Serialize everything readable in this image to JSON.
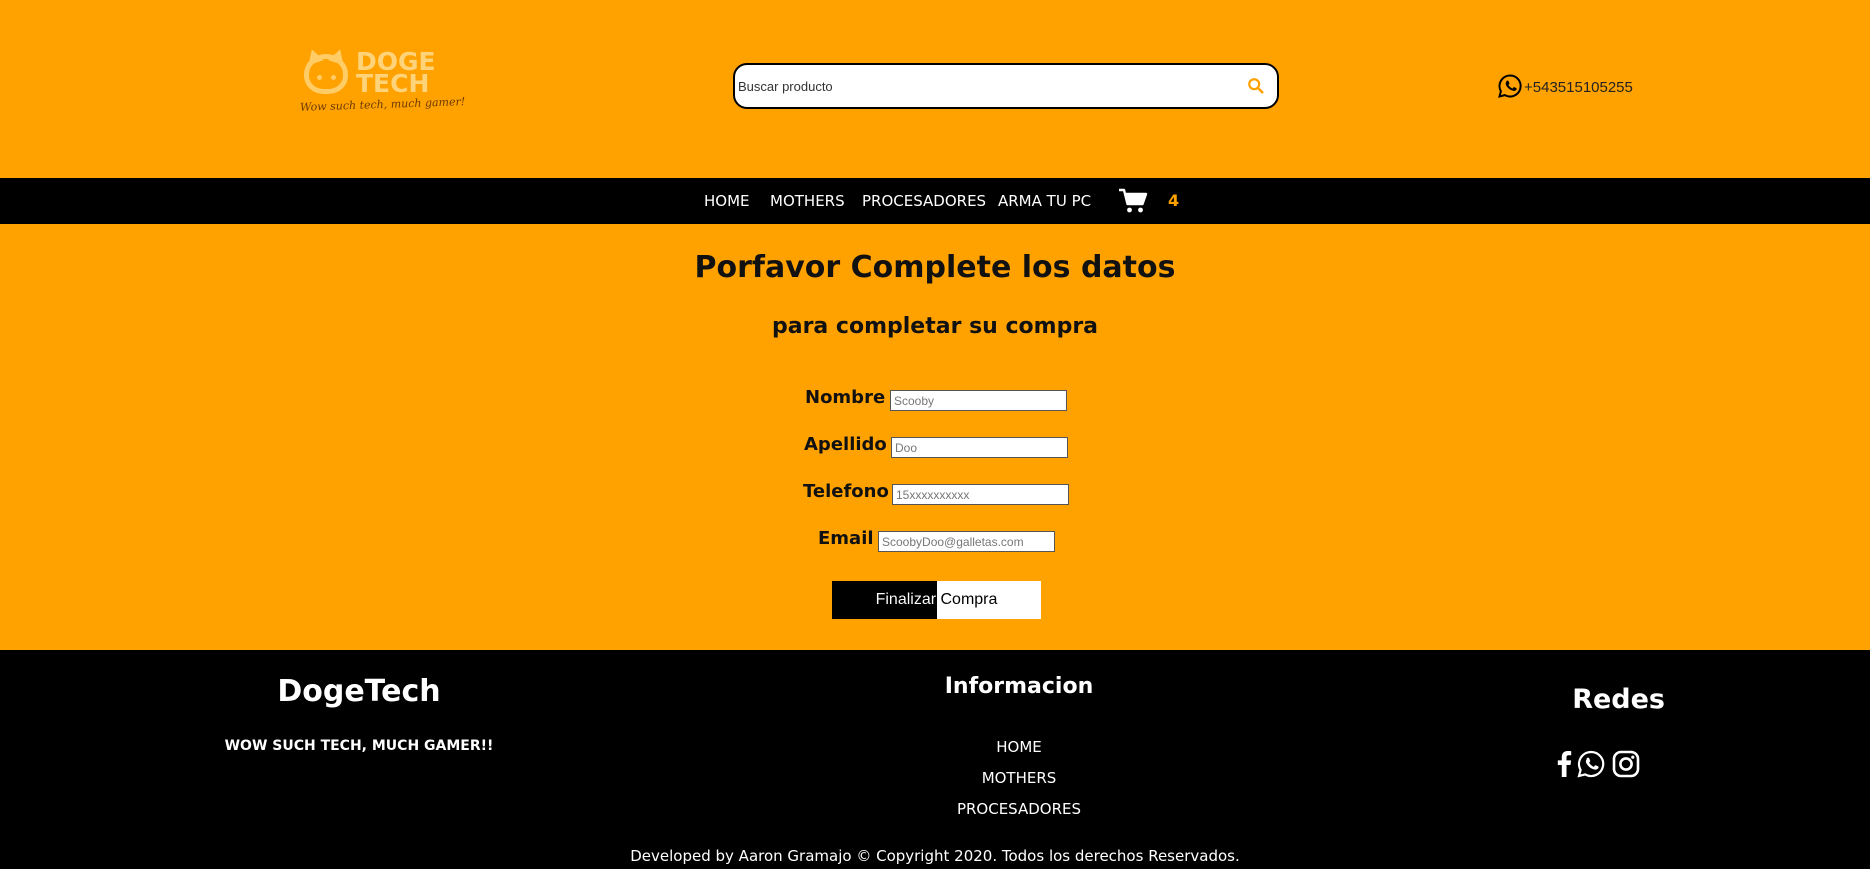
{
  "header": {
    "logo": {
      "line1": "DOGE",
      "line2": "TECH",
      "tagline": "Wow such tech, much gamer!"
    },
    "search": {
      "placeholder": "Buscar producto",
      "icon": "search-icon"
    },
    "phone": {
      "icon": "whatsapp-icon",
      "number": "+543515105255"
    }
  },
  "nav": {
    "items": [
      {
        "label": "HOME"
      },
      {
        "label": "MOTHERS"
      },
      {
        "label": "PROCESADORES"
      },
      {
        "label": "ARMA TU PC"
      }
    ],
    "cart": {
      "icon": "cart-icon",
      "count": "4"
    }
  },
  "main": {
    "title": "Porfavor Complete los datos",
    "subtitle": "para completar su compra",
    "fields": [
      {
        "label": "Nombre",
        "placeholder": "Scooby"
      },
      {
        "label": "Apellido",
        "placeholder": "Doo"
      },
      {
        "label": "Telefono",
        "placeholder": "15xxxxxxxxxx"
      },
      {
        "label": "Email",
        "placeholder": "ScoobyDoo@galletas.com"
      }
    ],
    "submit_label": "Finalizar Compra"
  },
  "footer": {
    "brand": "DogeTech",
    "slogan": "WOW SUCH TECH, MUCH GAMER!!",
    "info_title": "Informacion",
    "links": [
      {
        "label": "HOME"
      },
      {
        "label": "MOTHERS"
      },
      {
        "label": "PROCESADORES"
      }
    ],
    "social_title": "Redes",
    "social_icons": [
      "facebook-icon",
      "whatsapp-icon",
      "instagram-icon"
    ],
    "copyright": "Developed by Aaron Gramajo © Copyright 2020. Todos los derechos Reservados."
  },
  "colors": {
    "background": "#ffa200",
    "nav": "#000000",
    "accent": "#ffa200"
  }
}
